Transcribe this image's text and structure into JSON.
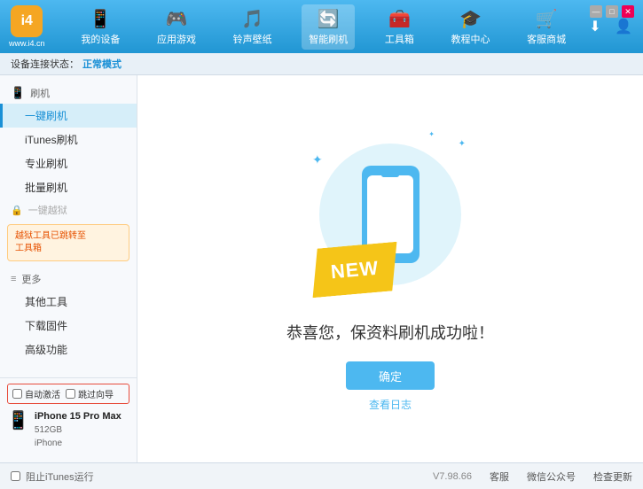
{
  "app": {
    "logo_text": "www.i4.cn",
    "logo_abbr": "i4"
  },
  "window_controls": {
    "minimize": "—",
    "maximize": "□",
    "close": "✕"
  },
  "nav": {
    "items": [
      {
        "id": "my-device",
        "label": "我的设备",
        "icon": "📱"
      },
      {
        "id": "app-game",
        "label": "应用游戏",
        "icon": "🎮"
      },
      {
        "id": "ringtone",
        "label": "铃声壁纸",
        "icon": "🎵"
      },
      {
        "id": "smart-flash",
        "label": "智能刷机",
        "icon": "🔄",
        "active": true
      },
      {
        "id": "toolbox",
        "label": "工具箱",
        "icon": "🧰"
      },
      {
        "id": "tutorial",
        "label": "教程中心",
        "icon": "🎓"
      },
      {
        "id": "service",
        "label": "客服商城",
        "icon": "🛒"
      }
    ]
  },
  "header_right": {
    "download_icon": "⬇",
    "user_icon": "👤"
  },
  "status_bar": {
    "label": "设备连接状态：",
    "value": "正常模式"
  },
  "sidebar": {
    "flash_section": {
      "label": "刷机",
      "icon": "📱"
    },
    "items": [
      {
        "id": "one-click",
        "label": "一键刷机",
        "active": true
      },
      {
        "id": "itunes",
        "label": "iTunes刷机"
      },
      {
        "id": "pro-flash",
        "label": "专业刷机"
      },
      {
        "id": "batch",
        "label": "批量刷机"
      }
    ],
    "disabled_section": {
      "icon": "🔒",
      "label": "一键越狱"
    },
    "notice": "越狱工具已跳转至\n工具箱",
    "more_section": {
      "label": "更多",
      "icon": "≡"
    },
    "more_items": [
      {
        "id": "other-tools",
        "label": "其他工具"
      },
      {
        "id": "download-fw",
        "label": "下载固件"
      },
      {
        "id": "advanced",
        "label": "高级功能"
      }
    ],
    "auto_options": {
      "auto_activate": "自动激活",
      "auto_guide": "跳过向导"
    },
    "device": {
      "name": "iPhone 15 Pro Max",
      "storage": "512GB",
      "type": "iPhone",
      "icon": "📱"
    }
  },
  "content": {
    "success_text": "恭喜您，保资料刷机成功啦！",
    "confirm_btn": "确定",
    "log_link": "查看日志",
    "new_badge": "NEW"
  },
  "footer": {
    "stop_itunes": "阻止iTunes运行",
    "version": "V7.98.66",
    "links": [
      "客服",
      "微信公众号",
      "检查更新"
    ]
  }
}
